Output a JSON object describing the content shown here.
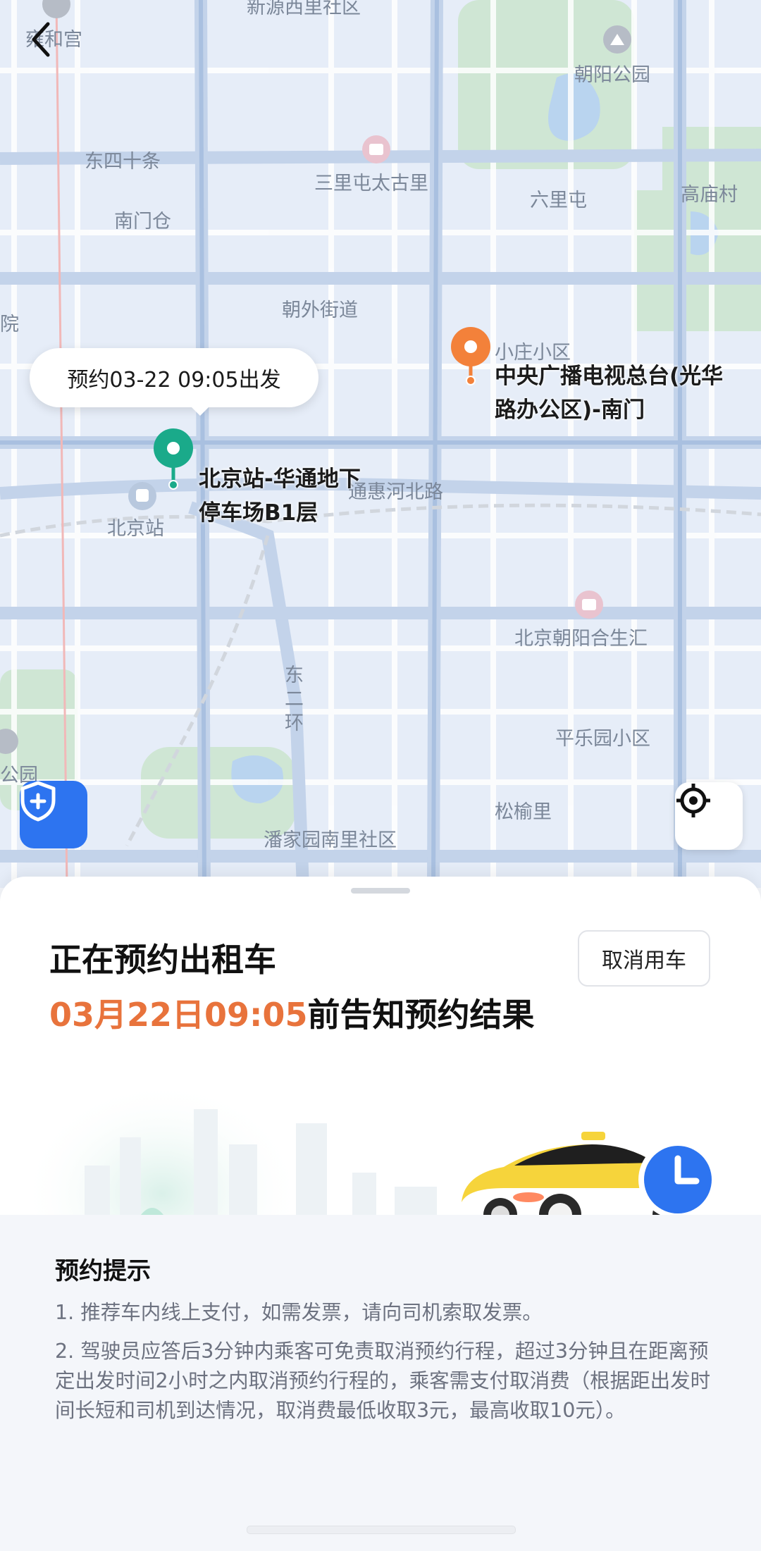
{
  "map": {
    "labels": [
      "雍和宫",
      "新源西里社区",
      "朝阳公园",
      "东四十条",
      "三里屯太古里",
      "六里屯",
      "高庙村",
      "南门仓",
      "朝外街道",
      "小庄小区",
      "院",
      "北京站",
      "通惠河北路",
      "北京朝阳合生汇",
      "东",
      "二",
      "环",
      "平乐园小区",
      "公园",
      "松榆里",
      "潘家园南里社区"
    ],
    "bubble_text": "预约03-22 09:05出发",
    "start_label": [
      "北京站-华通地下",
      "停车场B1层"
    ],
    "end_label": [
      "中央广播电视总台(光华",
      "路办公区)-南门"
    ]
  },
  "sheet": {
    "title": "正在预约出租车",
    "subtitle_accent": "03月22日09:05",
    "subtitle_rest": "前告知预约结果",
    "cancel_label": "取消用车",
    "tips_title": "预约提示",
    "tips": [
      "1. 推荐车内线上支付，如需发票，请向司机索取发票。",
      "2. 驾驶员应答后3分钟内乘客可免责取消预约行程，超过3分钟且在距离预定出发时间2小时之内取消预约行程的，乘客需支付取消费（根据距出发时间长短和司机到达情况，取消费最低收取3元，最高收取10元）。"
    ]
  },
  "colors": {
    "accent_orange": "#e8733c",
    "start_green": "#1aaa8a",
    "end_orange": "#f3813a",
    "shield_blue": "#2d74f0"
  },
  "icons": [
    "back-icon",
    "shield-plus-icon",
    "locate-icon",
    "start-pin-icon",
    "end-pin-icon",
    "train-station-icon",
    "mall-icon",
    "park-icon",
    "clock-icon",
    "taxi-icon"
  ]
}
